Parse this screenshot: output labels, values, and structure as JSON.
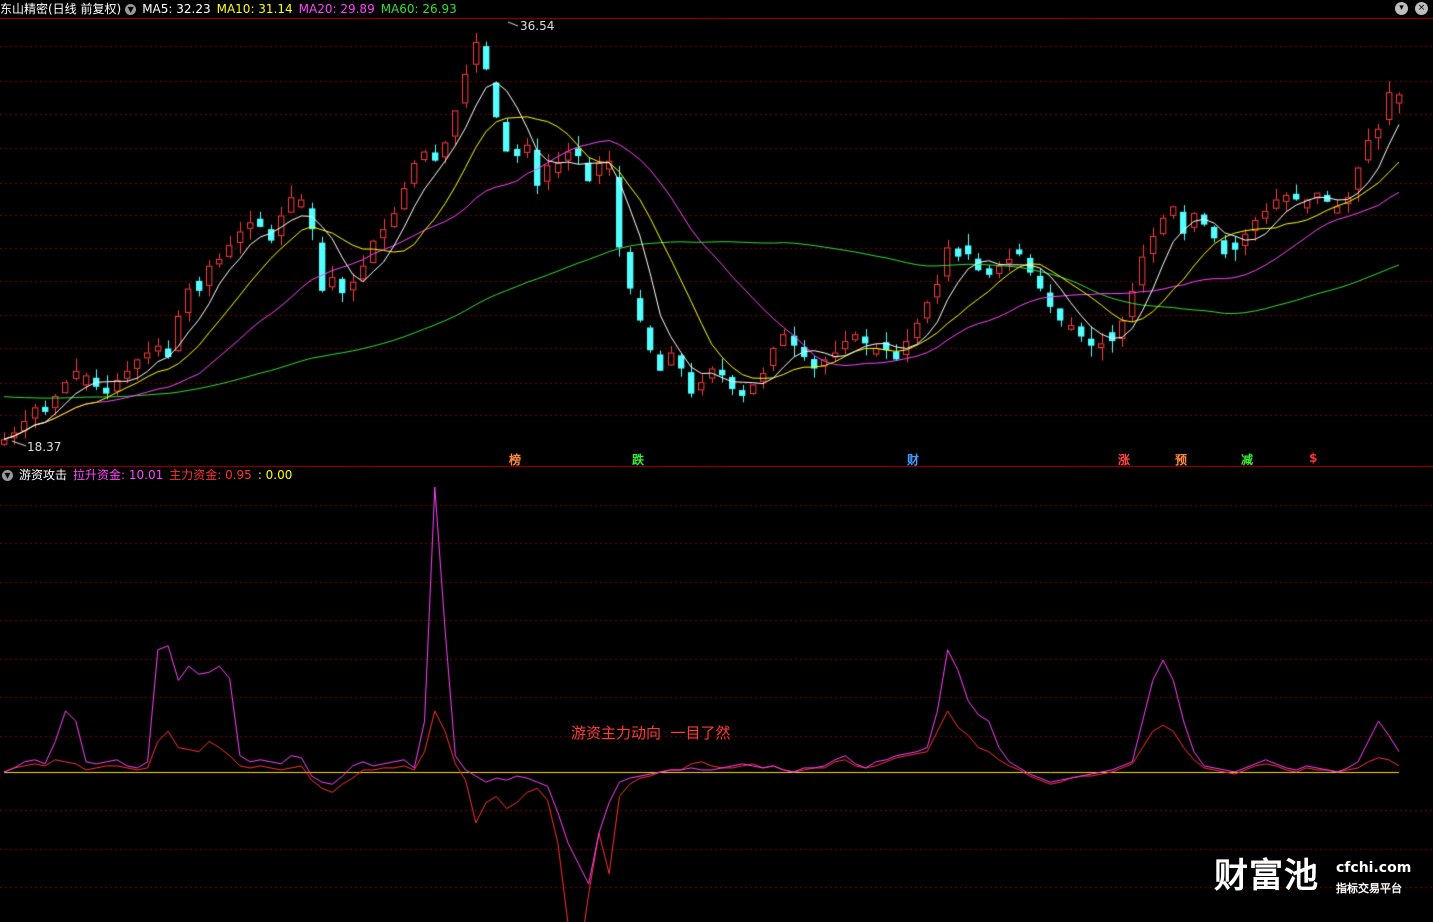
{
  "header": {
    "title": "东山精密(日线 前复权)",
    "ma": [
      {
        "label": "MA5: 32.23",
        "color": "#ffffff"
      },
      {
        "label": "MA10: 31.14",
        "color": "#ffff00"
      },
      {
        "label": "MA20: 29.89",
        "color": "#ff44ff"
      },
      {
        "label": "MA60: 26.93",
        "color": "#33dd33"
      }
    ]
  },
  "indicator": {
    "name": "游资攻击",
    "lines": [
      {
        "label": "拉升资金: 10.01",
        "color": "#ff44ff"
      },
      {
        "label": "主力资金: 0.95",
        "color": "#ff3333"
      },
      {
        "label": ": 0.00",
        "color": "#ffff00"
      }
    ]
  },
  "annotations": {
    "high_label": "36.54",
    "low_label": "18.37",
    "center_text": "游资主力动向  一目了然"
  },
  "events": [
    {
      "label": "榜",
      "color": "#ff8a3c"
    },
    {
      "label": "跌",
      "color": "#33ee33"
    },
    {
      "label": "财",
      "color": "#4499ff"
    },
    {
      "label": "涨",
      "color": "#ff4444"
    },
    {
      "label": "预",
      "color": "#ff8a3c"
    },
    {
      "label": "减",
      "color": "#33ee33"
    },
    {
      "label": "$",
      "color": "#ff3333"
    }
  ],
  "colors": {
    "up": "#ff3b3b",
    "down": "#54ffff",
    "ma5": "#ffffff",
    "ma10": "#ffff00",
    "ma20": "#ff44ff",
    "ma60": "#33dd33",
    "grid": "#7a0000",
    "separator": "#aa0000",
    "zero_line": "#ffd700"
  },
  "chart_data": {
    "type": "candlestick",
    "price": {
      "close": [
        18.4,
        18.7,
        19.2,
        19.8,
        19.6,
        20.3,
        20.9,
        21.4,
        21.2,
        20.7,
        20.4,
        21.0,
        21.4,
        21.9,
        22.2,
        22.5,
        22.0,
        23.8,
        25.0,
        24.9,
        26.0,
        26.3,
        26.9,
        27.5,
        27.9,
        27.7,
        27.1,
        28.2,
        29.0,
        28.9,
        27.6,
        24.9,
        25.5,
        24.8,
        25.3,
        26.0,
        27.1,
        27.6,
        28.3,
        29.4,
        30.5,
        31.0,
        30.6,
        31.4,
        32.8,
        34.4,
        35.8,
        34.6,
        32.5,
        31.0,
        30.8,
        31.3,
        29.5,
        30.4,
        30.5,
        31.0,
        30.8,
        29.7,
        30.5,
        30.6,
        26.8,
        25.0,
        23.6,
        22.3,
        21.4,
        22.2,
        21.5,
        20.4,
        20.9,
        21.5,
        21.2,
        20.6,
        20.3,
        20.8,
        21.3,
        22.4,
        23.0,
        22.5,
        22.0,
        21.5,
        21.9,
        22.2,
        22.7,
        23.0,
        22.6,
        22.4,
        22.3,
        21.9,
        22.7,
        23.5,
        24.4,
        25.2,
        26.8,
        26.4,
        26.5,
        25.8,
        25.6,
        26.0,
        26.3,
        26.5,
        25.7,
        25.0,
        24.2,
        23.6,
        23.4,
        22.9,
        22.5,
        22.6,
        22.7,
        23.6,
        24.9,
        26.4,
        27.3,
        28.1,
        28.6,
        27.4,
        28.3,
        27.8,
        27.2,
        26.5,
        26.7,
        27.4,
        28.0,
        28.4,
        28.9,
        29.1,
        28.9,
        28.9,
        29.2,
        28.8,
        28.6,
        29.0,
        30.3,
        31.5,
        32.0,
        33.6,
        33.5
      ],
      "ylim": [
        18.37,
        36.54
      ],
      "ma60_start": 20.3,
      "high": 36.54,
      "low": 18.37
    },
    "indicator": {
      "lift_capital": [
        0.0,
        0.2,
        0.5,
        0.6,
        0.4,
        1.5,
        3.0,
        2.5,
        0.5,
        0.4,
        0.5,
        0.6,
        0.3,
        0.2,
        0.5,
        6.0,
        6.2,
        4.5,
        5.2,
        4.8,
        4.9,
        5.2,
        4.6,
        0.8,
        0.5,
        0.6,
        0.5,
        0.4,
        0.8,
        0.7,
        -0.2,
        -0.5,
        -0.6,
        -0.2,
        0.3,
        0.5,
        0.3,
        0.4,
        0.5,
        0.6,
        0.2,
        2.5,
        14.0,
        7.0,
        0.8,
        0.1,
        -0.2,
        -0.5,
        -0.3,
        -0.4,
        -0.2,
        -0.3,
        -0.5,
        -0.7,
        -2.0,
        -3.5,
        -4.5,
        -5.5,
        -3.0,
        -1.5,
        -0.5,
        -0.3,
        -0.2,
        -0.1,
        0.0,
        0.1,
        0.1,
        0.2,
        0.1,
        0.1,
        0.2,
        0.3,
        0.4,
        0.3,
        0.2,
        0.3,
        0.1,
        0.0,
        0.2,
        0.2,
        0.3,
        0.6,
        0.8,
        0.4,
        0.2,
        0.5,
        0.6,
        0.8,
        0.9,
        1.0,
        1.2,
        3.0,
        6.0,
        5.0,
        3.5,
        2.8,
        2.5,
        1.2,
        0.5,
        0.2,
        -0.1,
        -0.3,
        -0.5,
        -0.4,
        -0.3,
        -0.2,
        -0.1,
        0.0,
        0.1,
        0.3,
        0.5,
        2.5,
        4.5,
        5.5,
        4.5,
        2.5,
        1.0,
        0.3,
        0.2,
        0.1,
        0.0,
        0.2,
        0.4,
        0.6,
        0.4,
        0.2,
        0.1,
        0.3,
        0.2,
        0.1,
        0.0,
        0.2,
        0.5,
        1.5,
        2.5,
        1.8,
        1.0
      ],
      "main_capital": [
        0.0,
        0.2,
        0.3,
        0.4,
        0.3,
        0.6,
        0.5,
        0.4,
        0.1,
        0.2,
        0.3,
        0.3,
        0.2,
        0.1,
        0.2,
        1.5,
        2.0,
        1.2,
        1.1,
        1.0,
        1.5,
        1.2,
        0.8,
        0.3,
        0.2,
        0.3,
        0.2,
        0.1,
        0.2,
        0.3,
        -0.4,
        -0.8,
        -1.0,
        -0.6,
        -0.3,
        0.1,
        0.1,
        0.2,
        0.2,
        0.3,
        0.1,
        1.0,
        3.0,
        2.0,
        0.4,
        -0.4,
        -2.5,
        -1.5,
        -1.2,
        -1.8,
        -1.5,
        -1.0,
        -0.8,
        -1.4,
        -3.5,
        -7.5,
        -9.5,
        -6.0,
        -3.0,
        -5.0,
        -1.2,
        -0.6,
        -0.3,
        -0.2,
        0.0,
        0.1,
        0.1,
        0.4,
        0.5,
        0.3,
        0.2,
        0.2,
        0.3,
        0.4,
        0.2,
        0.3,
        0.1,
        0.0,
        0.1,
        0.2,
        0.2,
        0.5,
        0.6,
        0.3,
        0.2,
        0.3,
        0.5,
        0.7,
        0.8,
        0.9,
        1.0,
        2.0,
        3.0,
        2.2,
        1.8,
        1.2,
        1.0,
        0.6,
        0.3,
        0.1,
        -0.2,
        -0.4,
        -0.6,
        -0.5,
        -0.3,
        -0.2,
        -0.2,
        -0.1,
        0.0,
        0.2,
        0.4,
        1.2,
        2.0,
        2.3,
        2.0,
        1.2,
        0.6,
        0.2,
        0.1,
        0.0,
        -0.1,
        0.1,
        0.3,
        0.4,
        0.3,
        0.1,
        0.0,
        0.2,
        0.1,
        0.1,
        0.0,
        0.1,
        0.2,
        0.5,
        0.7,
        0.6,
        0.3
      ],
      "zero": 0.0
    }
  }
}
